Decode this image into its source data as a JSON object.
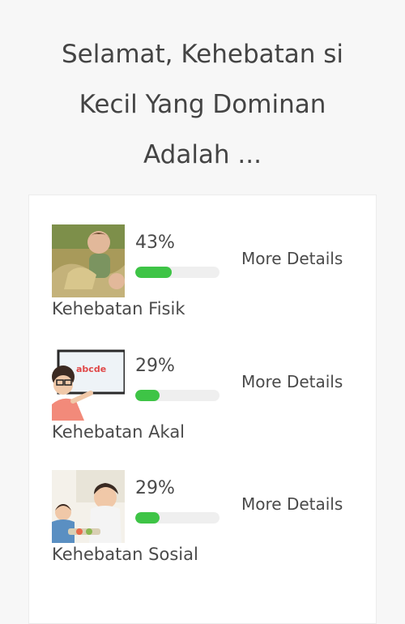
{
  "heading": {
    "line1": "Selamat, Kehebatan si",
    "line2": "Kecil Yang Dominan",
    "line3": "Adalah ..."
  },
  "results": [
    {
      "label": "Kehebatan Fisik",
      "percent_text": "43%",
      "percent": 43,
      "more_label": "More Details",
      "image": "child-playing-outdoors-photo"
    },
    {
      "label": "Kehebatan Akal",
      "percent_text": "29%",
      "percent": 29,
      "more_label": "More Details",
      "image": "child-at-alphabet-board-photo"
    },
    {
      "label": "Kehebatan Sosial",
      "percent_text": "29%",
      "percent": 29,
      "more_label": "More Details",
      "image": "children-eating-together-photo"
    }
  ],
  "colors": {
    "progress_fill": "#3ec446",
    "progress_track": "#efefef",
    "text": "#4a4a4a"
  }
}
